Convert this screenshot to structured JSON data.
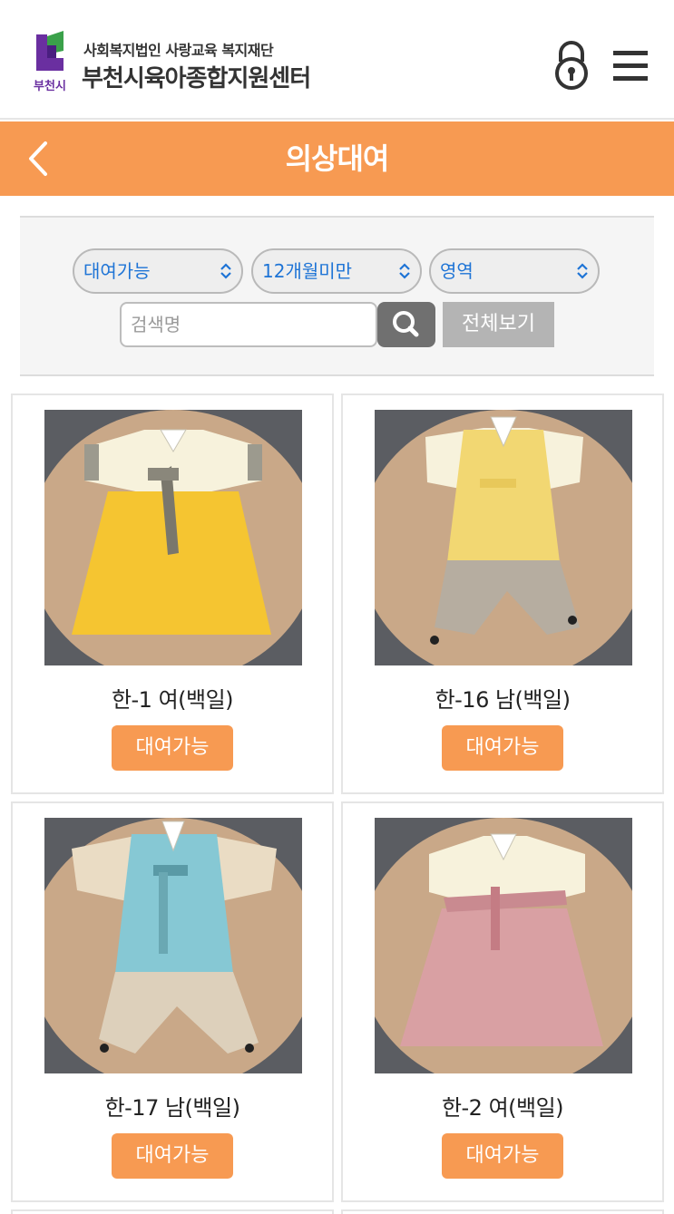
{
  "header": {
    "org_subtitle": "사회복지법인 사랑교육 복지재단",
    "org_title": "부천시육아종합지원센터",
    "logo_text": "부천시",
    "lock_icon": "lock-icon",
    "menu_icon": "hamburger-menu-icon"
  },
  "title_bar": {
    "title": "의상대여",
    "back_icon": "chevron-left-icon"
  },
  "filters": {
    "status_value": "대여가능",
    "age_value": "12개월미만",
    "area_value": "영역",
    "search_placeholder": "검색명",
    "search_value": "",
    "search_icon": "search-icon",
    "view_all_label": "전체보기"
  },
  "products": [
    {
      "name": "한-1 여(백일)",
      "status": "대여가능"
    },
    {
      "name": "한-16 남(백일)",
      "status": "대여가능"
    },
    {
      "name": "한-17 남(백일)",
      "status": "대여가능"
    },
    {
      "name": "한-2 여(백일)",
      "status": "대여가능"
    }
  ],
  "colors": {
    "accent": "#f79a52",
    "link_blue": "#1e74d6",
    "logo_purple": "#6a2fa0",
    "logo_green": "#3aa14a"
  }
}
